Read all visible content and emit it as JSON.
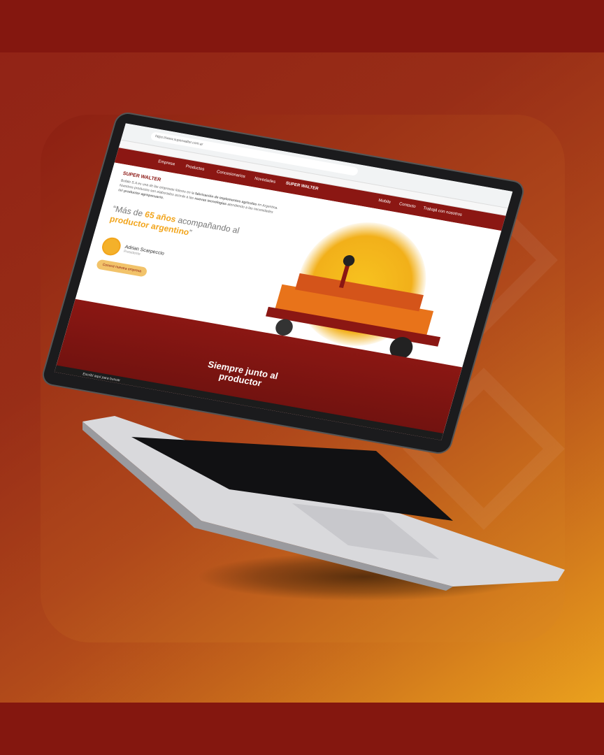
{
  "browser": {
    "url": "https://www.superwalter.com.ar"
  },
  "site": {
    "nav": {
      "items": [
        "Empresa",
        "Productos",
        "Concesionarios",
        "Novedades"
      ],
      "right_items": [
        "Mobile",
        "Contacto",
        "Trabajá con nosotros"
      ],
      "logo": "SUPER WALTER"
    },
    "hero": {
      "logo_small": "SUPER WALTER",
      "description_start": "Bufalo S.A es una de las empresas líderes en la",
      "description_bold1": "fabricación de implementos agrícolas",
      "description_mid": "en Argentina. Nuestros productos son elaborados acorde a las",
      "description_bold2": "nuevas tecnologías",
      "description_end": "atendiendo a las necesidades del",
      "description_bold3": "productor agropecuario.",
      "quote_prefix": "“Más de",
      "quote_highlight": "65 años",
      "quote_mid": "acompañando al",
      "quote_highlight2": "productor argentino",
      "quote_suffix": "”",
      "person_name": "Adrian Scarpeccio",
      "person_role": "Presidente",
      "cta": "Conocé nuestra empresa",
      "banner_title_line1": "Siempre junto al",
      "banner_title_line2": "productor"
    }
  },
  "taskbar": {
    "search": "Escribí aquí para buscar"
  },
  "colors": {
    "brand_red": "#8b1713",
    "brand_yellow": "#f2a51c",
    "background_dark": "#84170f",
    "background_light": "#f5b81e"
  }
}
